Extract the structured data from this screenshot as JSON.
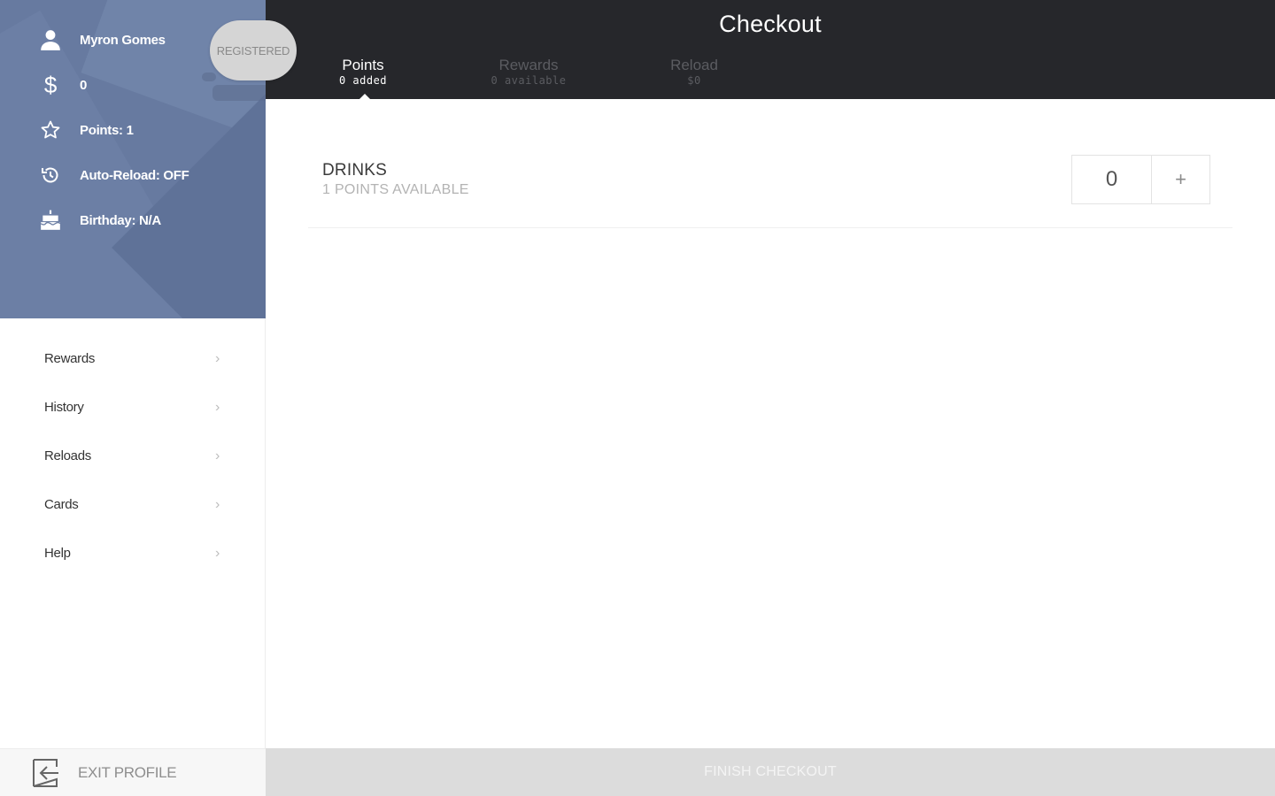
{
  "profile": {
    "name": "Myron Gomes",
    "balance": "0",
    "points": "Points: 1",
    "auto_reload": "Auto-Reload: OFF",
    "birthday": "Birthday: N/A",
    "status_badge": "REGISTERED",
    "colors": {
      "panel": "#677aa0",
      "badge": "#d5d5d5"
    },
    "icons": [
      "user-icon",
      "dollar-icon",
      "star-icon",
      "history-icon",
      "cake-icon"
    ]
  },
  "sidebar": {
    "items": [
      {
        "label": "Rewards"
      },
      {
        "label": "History"
      },
      {
        "label": "Reloads"
      },
      {
        "label": "Cards"
      },
      {
        "label": "Help"
      }
    ],
    "exit_label": "EXIT PROFILE"
  },
  "header": {
    "title": "Checkout",
    "tabs": [
      {
        "label": "Points",
        "sub": "0 added",
        "active": true
      },
      {
        "label": "Rewards",
        "sub": "0 available",
        "active": false
      },
      {
        "label": "Reload",
        "sub": "$0",
        "active": false
      }
    ],
    "colors": {
      "background": "#26272b"
    }
  },
  "content": {
    "items": [
      {
        "name": "DRINKS",
        "sub": "1 POINTS AVAILABLE",
        "quantity": "0",
        "plus": "+"
      }
    ]
  },
  "footer": {
    "finish_label": "FINISH CHECKOUT",
    "colors": {
      "background": "#dcdcdc"
    }
  }
}
